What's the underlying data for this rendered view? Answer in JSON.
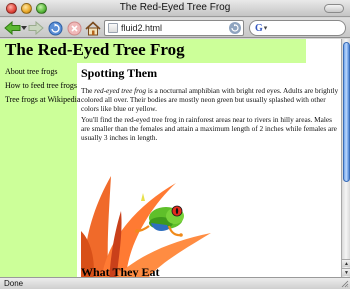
{
  "window": {
    "title": "The Red-Eyed Tree Frog"
  },
  "toolbar": {
    "url": "fluid2.html",
    "search_engine_icon": "G",
    "search_value": ""
  },
  "page": {
    "heading": "The Red-Eyed Tree Frog",
    "nav": [
      {
        "label": "About tree frogs"
      },
      {
        "label": "How to feed tree frogs"
      },
      {
        "label": "Tree frogs at Wikipedia"
      }
    ],
    "section1": {
      "heading": "Spotting Them",
      "p1_before": "The ",
      "p1_em": "red-eyed tree frog",
      "p1_after": " is a nocturnal amphibian with bright red eyes. Adults are brightly colored all over. Their bodies are mostly neon green but usually splashed with other colors like blue or yellow.",
      "p2": "You'll find the red-eyed tree frog in rainforest areas near to rivers in hilly areas. Males are smaller than the females and attain a maximum length of 2 inches while females are usually 3 inches in length."
    },
    "section2": {
      "heading": "What They Eat"
    }
  },
  "status": {
    "text": "Done"
  },
  "colors": {
    "banner_bg": "#ccff99",
    "sidebar_bg": "#ccff99",
    "scroll_thumb": "#6fa3e8"
  },
  "icons": [
    "back-arrow-icon",
    "forward-arrow-icon",
    "reload-icon",
    "stop-icon",
    "home-icon",
    "page-icon",
    "go-icon",
    "google-icon"
  ]
}
